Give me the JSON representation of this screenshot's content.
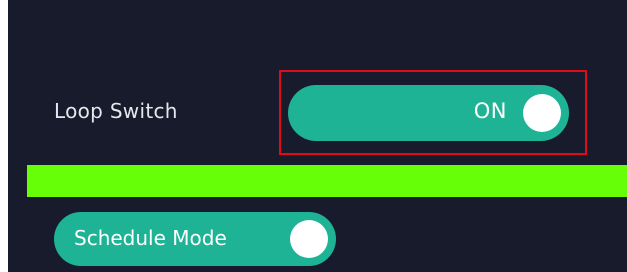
{
  "loop_switch": {
    "label": "Loop Switch",
    "state_text": "ON",
    "is_on": true
  },
  "schedule_mode": {
    "label": "Schedule Mode",
    "is_on": true
  },
  "colors": {
    "panel_background": "#171b2b",
    "toggle_accent": "#1fb395",
    "highlight_border": "#e00b18",
    "green_bar": "#66ff08",
    "text": "#e6e7ec"
  }
}
